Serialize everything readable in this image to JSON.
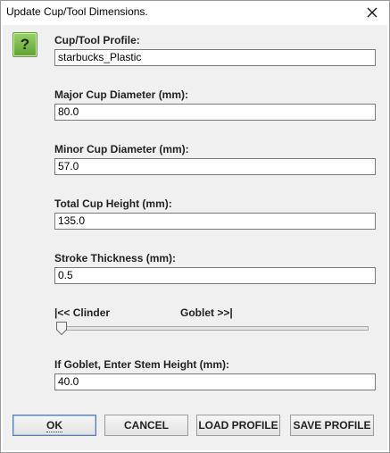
{
  "window": {
    "title": "Update Cup/Tool Dimensions."
  },
  "icons": {
    "help": "question-icon",
    "close": "close-icon"
  },
  "colors": {
    "help_icon": "#6fb43f"
  },
  "form": {
    "profile": {
      "label": "Cup/Tool Profile:",
      "value": "starbucks_Plastic"
    },
    "major_diameter": {
      "label": "Major Cup Diameter (mm):",
      "value": "80.0"
    },
    "minor_diameter": {
      "label": "Minor Cup Diameter (mm):",
      "value": "57.0"
    },
    "total_height": {
      "label": "Total Cup Height (mm):",
      "value": "135.0"
    },
    "stroke_thickness": {
      "label": "Stroke Thickness (mm):",
      "value": "0.5"
    },
    "shape_slider": {
      "left_label": "|<< Clinder",
      "right_label": "Goblet >>|",
      "value_fraction": 0
    },
    "stem_height": {
      "label": "If Goblet, Enter Stem Height (mm):",
      "value": "40.0"
    }
  },
  "buttons": {
    "ok": "OK",
    "cancel": "CANCEL",
    "load_profile": "LOAD PROFILE",
    "save_profile": "SAVE PROFILE"
  }
}
